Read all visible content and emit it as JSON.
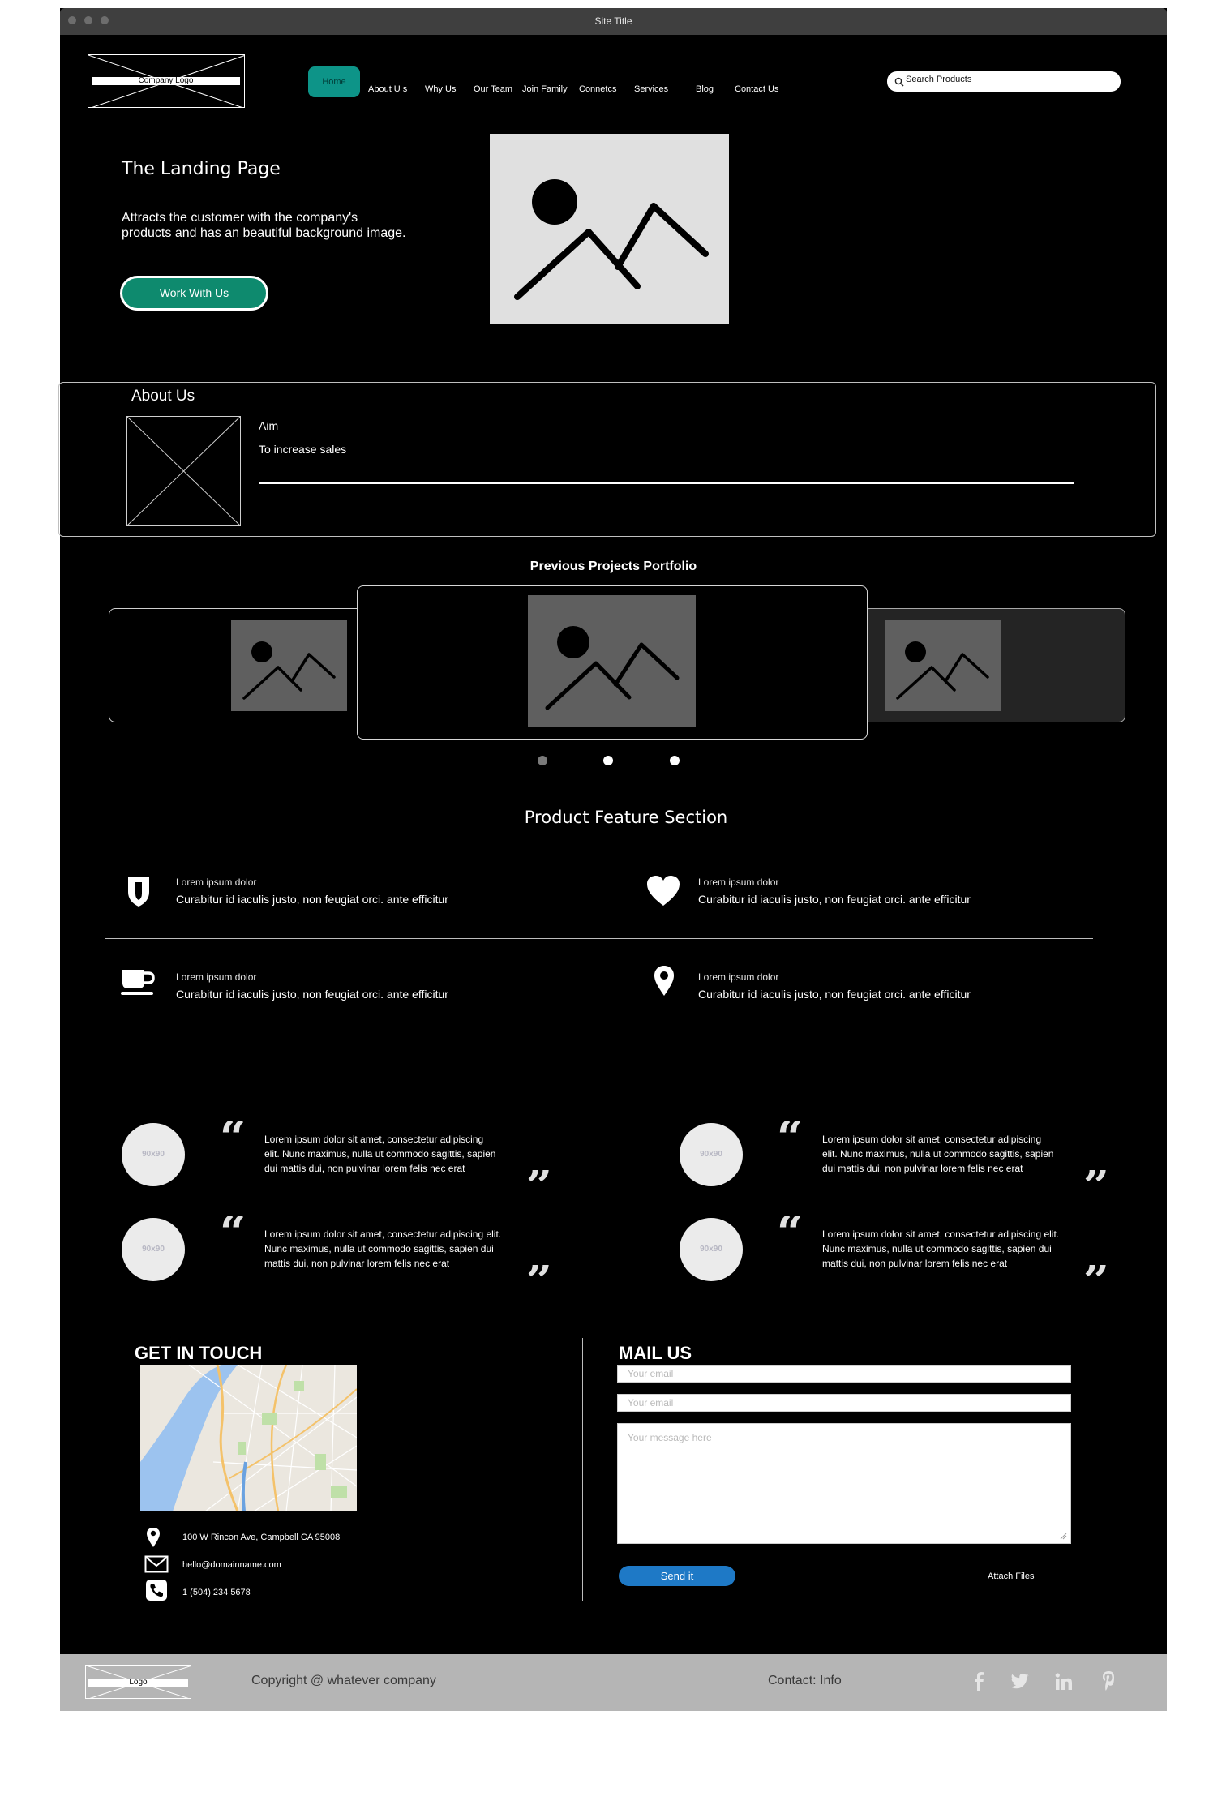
{
  "window": {
    "title": "Site Title"
  },
  "header": {
    "logo_label": "Company Logo",
    "nav": [
      "Home",
      "About U s",
      "Why Us",
      "Our Team",
      "Join Family",
      "Connetcs",
      "Services",
      "Blog",
      "Contact Us"
    ],
    "search_value": "Search Products"
  },
  "hero": {
    "title": "The Landing Page",
    "description_line1": "Attracts the customer with the company's",
    "description_line2": "products and has an beautiful background image.",
    "cta_label": "Work With Us"
  },
  "about": {
    "title": "About Us",
    "aim_label": "Aim",
    "aim_text": "To increase sales"
  },
  "portfolio": {
    "title": "Previous Projects Portfolio",
    "dots": 3,
    "active_dot": 1
  },
  "features": {
    "title": "Product Feature Section",
    "items": [
      {
        "icon": "shield-icon",
        "small": "Lorem ipsum dolor",
        "text": "Curabitur id iaculis justo, non feugiat orci. ante efficitur"
      },
      {
        "icon": "heart-icon",
        "small": "Lorem ipsum dolor",
        "text": "Curabitur id iaculis justo, non feugiat orci. ante efficitur"
      },
      {
        "icon": "coffee-cup-icon",
        "small": "Lorem ipsum dolor",
        "text": "Curabitur id iaculis justo, non feugiat orci. ante efficitur"
      },
      {
        "icon": "map-pin-icon",
        "small": "Lorem ipsum dolor",
        "text": "Curabitur id iaculis justo, non feugiat orci. ante efficitur"
      }
    ]
  },
  "testimonials": [
    {
      "avatar": "90x90",
      "l1": "Lorem ipsum dolor sit amet, consectetur adipiscing",
      "l2": "elit. Nunc maximus, nulla ut commodo sagittis, sapien",
      "l3": "dui mattis dui, non pulvinar lorem felis nec erat"
    },
    {
      "avatar": "90x90",
      "l1": "Lorem ipsum dolor sit amet, consectetur adipiscing",
      "l2": "elit. Nunc maximus, nulla ut commodo sagittis, sapien",
      "l3": "dui mattis dui, non pulvinar lorem felis nec erat"
    },
    {
      "avatar": "90x90",
      "l1": "Lorem ipsum dolor sit amet, consectetur adipiscing elit.",
      "l2": "Nunc maximus, nulla ut commodo sagittis, sapien dui",
      "l3": "mattis dui, non pulvinar lorem felis nec erat"
    },
    {
      "avatar": "90x90",
      "l1": "Lorem ipsum dolor sit amet, consectetur adipiscing elit.",
      "l2": "Nunc maximus, nulla ut commodo sagittis, sapien dui",
      "l3": "mattis dui, non pulvinar lorem felis nec erat"
    }
  ],
  "contact": {
    "get_in_touch_title": "GET IN TOUCH",
    "address": "100 W Rincon Ave, Campbell CA 95008",
    "email": "hello@domainname.com",
    "phone": "1 (504) 234 5678",
    "mail_us_title": "MAIL US",
    "email_placeholder_1": "Your email",
    "email_placeholder_2": "Your email",
    "message_placeholder": "Your message here",
    "send_label": "Send it",
    "attach_label": "Attach Files"
  },
  "footer": {
    "logo_label": "Logo",
    "copyright": "Copyright @ whatever company",
    "contact": "Contact: Info",
    "social": [
      "facebook-icon",
      "twitter-icon",
      "linkedin-icon",
      "pinterest-icon"
    ]
  },
  "colors": {
    "accent_teal": "#0d9488",
    "cta_green": "#0e8a6e",
    "send_blue": "#1e79c6",
    "footer_gray": "#b5b5b5"
  }
}
